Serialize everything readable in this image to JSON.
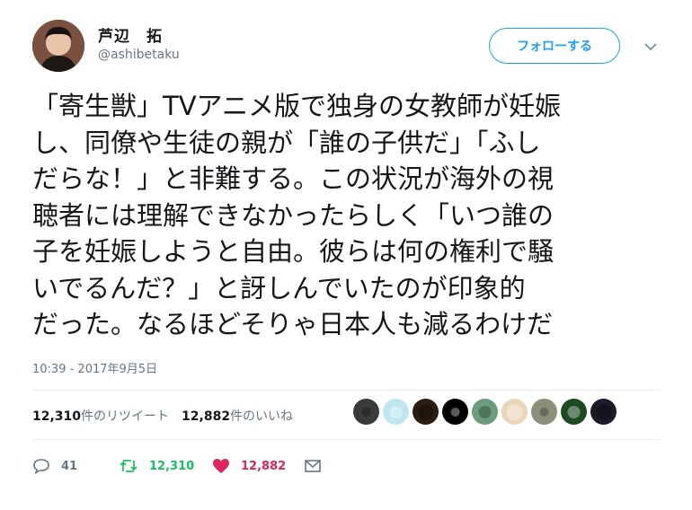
{
  "user": {
    "display_name": "芦辺　拓",
    "handle": "@ashibetaku"
  },
  "follow_button": {
    "label": "フォローする"
  },
  "tweet": {
    "lines": [
      "「寄生獣」TVアニメ版で独身の女教師が妊娠",
      "し、同僚や生徒の親が「誰の子供だ」「ふし",
      "だらな！」と非難する。この状況が海外の視",
      "聴者には理解できなかったらしく「いつ誰の",
      "子を妊娠しようと自由。彼らは何の権利で騒",
      "いでるんだ？」と訝しんでいたのが印象的",
      "だった。なるほどそりゃ日本人も減るわけだ"
    ],
    "timestamp": "10:39 - 2017年9月5日"
  },
  "stats": {
    "retweets_count": "12,310",
    "retweets_label": "件のリツイート",
    "likes_count": "12,882",
    "likes_label": "件のいいね"
  },
  "likers": [
    {
      "icon": "liker-avatar",
      "color": "#3a3a3a"
    },
    {
      "icon": "liker-avatar",
      "color": "#bfe6ef"
    },
    {
      "icon": "liker-avatar",
      "color": "#2b1d12"
    },
    {
      "icon": "liker-avatar",
      "color": "#000000"
    },
    {
      "icon": "liker-avatar",
      "color": "#6d9c7a"
    },
    {
      "icon": "liker-avatar",
      "color": "#e9d6b8"
    },
    {
      "icon": "liker-avatar",
      "color": "#8b8f7a"
    },
    {
      "icon": "liker-avatar",
      "color": "#1e4a22"
    },
    {
      "icon": "liker-avatar",
      "color": "#1b1b2a"
    }
  ],
  "actions": {
    "reply_count": "41",
    "retweet_count": "12,310",
    "like_count": "12,882"
  },
  "colors": {
    "accent": "#1da1f2",
    "retweet": "#17bf63",
    "like": "#e0245e",
    "secondary_text": "#657786"
  }
}
